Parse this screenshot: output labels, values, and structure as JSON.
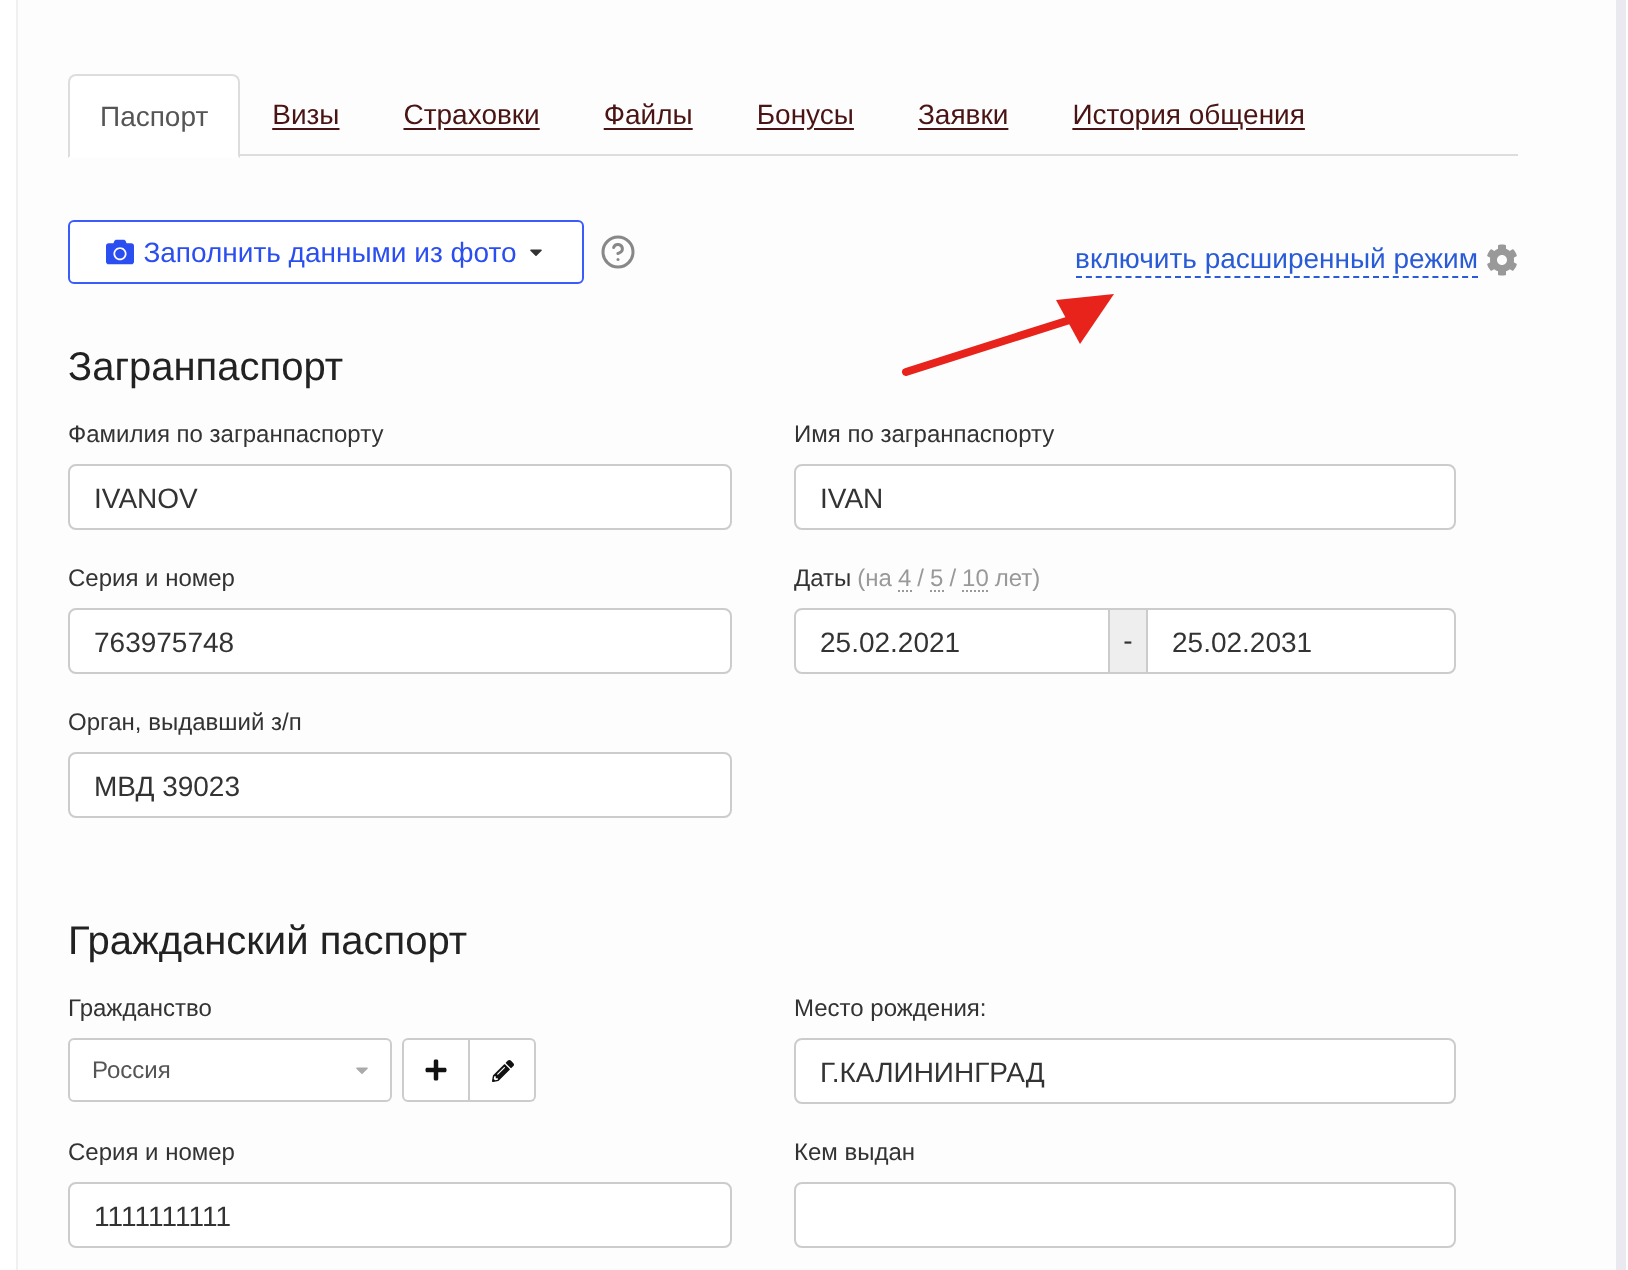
{
  "tabs": [
    {
      "label": "Паспорт",
      "selected": true
    },
    {
      "label": "Визы",
      "selected": false
    },
    {
      "label": "Страховки",
      "selected": false
    },
    {
      "label": "Файлы",
      "selected": false
    },
    {
      "label": "Бонусы",
      "selected": false
    },
    {
      "label": "Заявки",
      "selected": false
    },
    {
      "label": "История общения",
      "selected": false
    }
  ],
  "toolbar": {
    "fill_button": {
      "label": "Заполнить данными из фото"
    },
    "advanced_link": {
      "label": "включить расширенный режим"
    }
  },
  "sections": [
    {
      "title": "Загранпаспорт",
      "rows": [
        [
          {
            "kind": "text",
            "label": "Фамилия по загранпаспорту",
            "value": "IVANOV"
          },
          {
            "kind": "text",
            "label": "Имя по загранпаспорту",
            "value": "IVAN"
          }
        ],
        [
          {
            "kind": "text",
            "label": "Серия и номер",
            "value": "763975748"
          },
          {
            "kind": "date_range",
            "label": "Даты",
            "hint": {
              "prefix": "(на",
              "options": [
                "4",
                "5",
                "10"
              ],
              "separator": "/",
              "suffix": "лет)"
            },
            "from": "25.02.2021",
            "separator": "-",
            "to": "25.02.2031"
          }
        ],
        [
          {
            "kind": "text",
            "label": "Орган, выдавший з/п",
            "value": "МВД 39023"
          }
        ]
      ]
    },
    {
      "title": "Гражданский паспорт",
      "rows": [
        [
          {
            "kind": "select",
            "label": "Гражданство",
            "value": "Россия"
          },
          {
            "kind": "text",
            "label": "Место рождения:",
            "value": "Г.КАЛИНИНГРАД"
          }
        ],
        [
          {
            "kind": "text",
            "label": "Серия и номер",
            "value": "1111111111"
          },
          {
            "kind": "text",
            "label": "Кем выдан"
          }
        ]
      ]
    }
  ]
}
